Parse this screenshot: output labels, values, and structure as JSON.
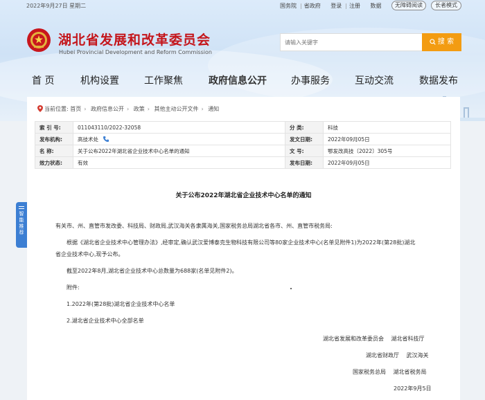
{
  "topbar": {
    "date": "2022年9月27日 星期二",
    "links": [
      "国务院",
      "省政府",
      "登录",
      "注册",
      "数据"
    ],
    "accessible": "无障碍阅读",
    "elder": "长者模式"
  },
  "site": {
    "title": "湖北省发展和改革委员会",
    "subtitle": "Hubei Provincial Development and Reform Commission"
  },
  "search": {
    "placeholder": "请输入关键字",
    "button": "搜 索"
  },
  "nav": [
    "首 页",
    "机构设置",
    "工作聚焦",
    "政府信息公开",
    "办事服务",
    "互动交流",
    "数据发布"
  ],
  "breadcrumb": {
    "label": "当前位置:",
    "items": [
      "首页",
      "政府信息公开",
      "政策",
      "其他主动公开文件",
      "通知"
    ]
  },
  "meta": {
    "index_label": "索 引 号:",
    "index": "011043110/2022-32058",
    "category_label": "分 类:",
    "category": "科技",
    "issuer_label": "发布机构:",
    "issuer": "高技术处",
    "issue_date_label": "发文日期:",
    "issue_date": "2022年09月05日",
    "name_label": "名 称:",
    "name": "关于公布2022年湖北省企业技术中心名单的通知",
    "doc_no_label": "文 号:",
    "doc_no": "鄂发改高技〔2022〕305号",
    "status_label": "效力状态:",
    "status": "有效",
    "pub_date_label": "发布日期:",
    "pub_date": "2022年09月05日"
  },
  "doc": {
    "title": "关于公布2022年湖北省企业技术中心名单的通知",
    "greeting": "有关市、州、直管市发改委、科技局、财政局,武汉海关各隶属海关,国家税务总局湖北省各市、州、直管市税务局:",
    "para1_line1": "根据《湖北省企业技术中心管理办法》,经审定,确认武汉爱博泰克生物科技有限公司等80家企业技术中心(名单见附件1)为2022年(第28批)湖北",
    "para1_line2": "省企业技术中心,现予公布。",
    "para2": "截至2022年8月,湖北省企业技术中心总数量为688家(名单见附件2)。",
    "attach_label": "附件:",
    "attach1": "1.2022年(第28批)湖北省企业技术中心名单",
    "attach2": "2.湖北省企业技术中心全部名单",
    "sign1": "湖北省发展和改革委员会　 湖北省科技厅",
    "sign2": "湖北省财政厅　 武汉海关",
    "sign3": "国家税务总局　 湖北省税务局",
    "date": "2022年9月5日"
  },
  "side_tab": [
    "智",
    "能",
    "推",
    "荐"
  ],
  "colors": {
    "brand_red": "#c4161c",
    "search_orange": "#f39c12",
    "side_blue": "#3c7fd3"
  }
}
